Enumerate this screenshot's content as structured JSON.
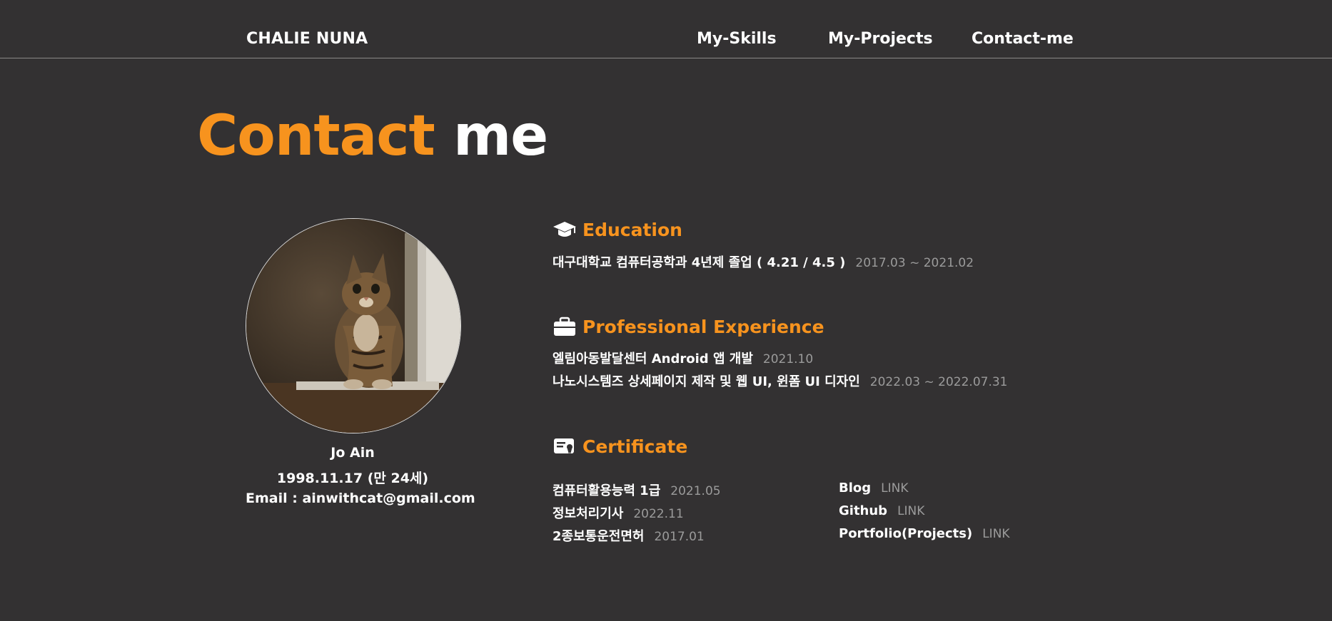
{
  "header": {
    "brand": "CHALIE NUNA",
    "nav": [
      "My-Skills",
      "My-Projects",
      "Contact-me"
    ]
  },
  "title": {
    "accent": "Contact",
    "rest": "me"
  },
  "profile": {
    "name": "Jo Ain",
    "birth": "1998.11.17 (만 24세)",
    "email": "Email : ainwithcat@gmail.com"
  },
  "education": {
    "heading": "Education",
    "icon": "graduation-cap-icon",
    "items": [
      {
        "text": "대구대학교 컴퓨터공학과 4년제 졸업 ( 4.21 / 4.5 )",
        "date": "2017.03 ~ 2021.02"
      }
    ]
  },
  "experience": {
    "heading": "Professional Experience",
    "icon": "briefcase-icon",
    "items": [
      {
        "text": "엘림아동발달센터 Android 앱 개발",
        "date": "2021.10"
      },
      {
        "text": "나노시스템즈 상세페이지 제작 및 웹 UI, 윈폼 UI 디자인",
        "date": "2022.03 ~ 2022.07.31"
      }
    ]
  },
  "certificate": {
    "heading": "Certificate",
    "icon": "certificate-icon",
    "items": [
      {
        "text": "컴퓨터활용능력 1급",
        "date": "2021.05"
      },
      {
        "text": "정보처리기사",
        "date": "2022.11"
      },
      {
        "text": "2종보통운전면허",
        "date": "2017.01"
      }
    ],
    "links": [
      {
        "text": "Blog",
        "link": "LINK"
      },
      {
        "text": "Github",
        "link": "LINK"
      },
      {
        "text": "Portfolio(Projects)",
        "link": "LINK"
      }
    ]
  },
  "colors": {
    "accent": "#f7931e",
    "background": "#333132",
    "muted": "#9b9b9b"
  }
}
